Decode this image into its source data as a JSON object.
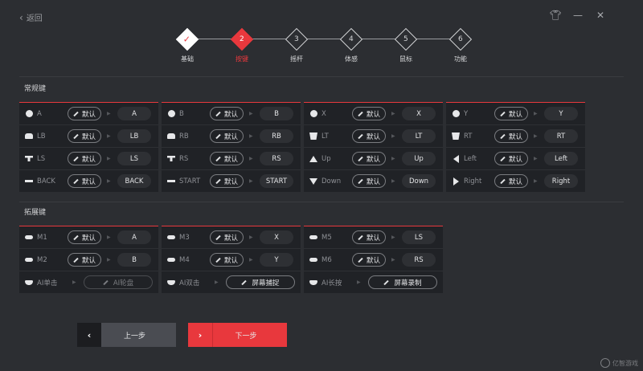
{
  "header": {
    "back_label": "返回"
  },
  "steps": [
    {
      "num": "✓",
      "label": "基础",
      "state": "done"
    },
    {
      "num": "2",
      "label": "按键",
      "state": "active"
    },
    {
      "num": "3",
      "label": "摇杆",
      "state": "todo"
    },
    {
      "num": "4",
      "label": "体感",
      "state": "todo"
    },
    {
      "num": "5",
      "label": "鼠标",
      "state": "todo"
    },
    {
      "num": "6",
      "label": "功能",
      "state": "todo"
    }
  ],
  "sections": {
    "standard": "常规键",
    "extended": "拓展键"
  },
  "default_label": "默认",
  "standard_cols": [
    [
      {
        "name": "A",
        "value": "A",
        "icon": "circle-icon"
      },
      {
        "name": "LB",
        "value": "LB",
        "icon": "bumper-icon"
      },
      {
        "name": "LS",
        "value": "LS",
        "icon": "stick-icon"
      },
      {
        "name": "BACK",
        "value": "BACK",
        "icon": "dash-icon"
      }
    ],
    [
      {
        "name": "B",
        "value": "B",
        "icon": "circle-icon"
      },
      {
        "name": "RB",
        "value": "RB",
        "icon": "bumper-icon"
      },
      {
        "name": "RS",
        "value": "RS",
        "icon": "stick-icon"
      },
      {
        "name": "START",
        "value": "START",
        "icon": "dash-icon"
      }
    ],
    [
      {
        "name": "X",
        "value": "X",
        "icon": "circle-icon"
      },
      {
        "name": "LT",
        "value": "LT",
        "icon": "trigger-icon"
      },
      {
        "name": "Up",
        "value": "Up",
        "icon": "dpad-up-icon"
      },
      {
        "name": "Down",
        "value": "Down",
        "icon": "dpad-down-icon"
      }
    ],
    [
      {
        "name": "Y",
        "value": "Y",
        "icon": "circle-icon"
      },
      {
        "name": "RT",
        "value": "RT",
        "icon": "trigger-icon"
      },
      {
        "name": "Left",
        "value": "Left",
        "icon": "dpad-left-icon"
      },
      {
        "name": "Right",
        "value": "Right",
        "icon": "dpad-right-icon"
      }
    ]
  ],
  "extended_cols": [
    [
      {
        "name": "M1",
        "value": "A"
      },
      {
        "name": "M2",
        "value": "B"
      },
      {
        "name": "AI单击",
        "wide": "AI轮盘",
        "dim": true
      }
    ],
    [
      {
        "name": "M3",
        "value": "X"
      },
      {
        "name": "M4",
        "value": "Y"
      },
      {
        "name": "AI双击",
        "wide": "屏幕捕捉",
        "dim": false
      }
    ],
    [
      {
        "name": "M5",
        "value": "LS"
      },
      {
        "name": "M6",
        "value": "RS"
      },
      {
        "name": "AI长按",
        "wide": "屏幕录制",
        "dim": false
      }
    ]
  ],
  "nav": {
    "prev_label": "上一步",
    "next_label": "下一步"
  },
  "watermark": "亿智游戏",
  "colors": {
    "accent": "#e8383d",
    "bg": "#2c2e32",
    "panel": "#202226"
  }
}
